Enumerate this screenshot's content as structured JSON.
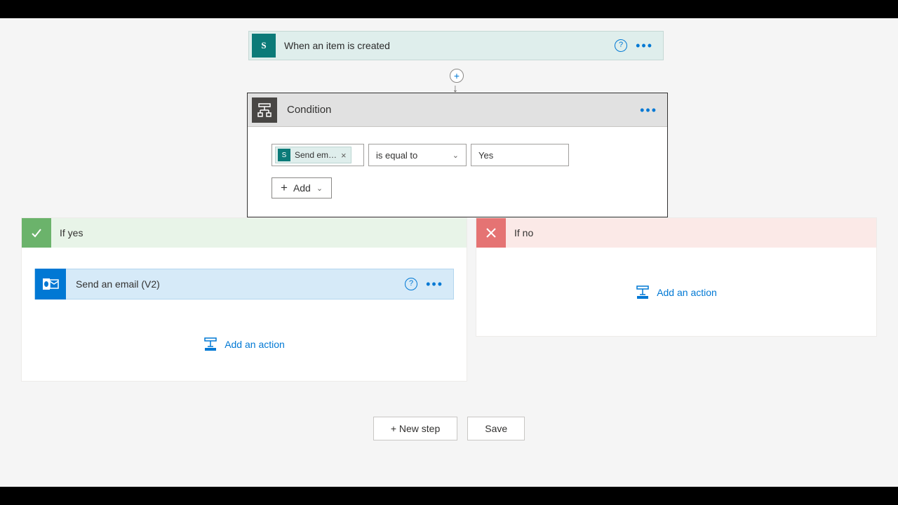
{
  "trigger": {
    "title": "When an item is created",
    "connector_short": "S",
    "help_tooltip": "?"
  },
  "condition": {
    "title": "Condition",
    "left_operand_label": "Send em…",
    "operator": "is equal to",
    "value": "Yes",
    "add_label": "Add"
  },
  "branches": {
    "yes": {
      "label": "If yes",
      "actions": [
        {
          "title": "Send an email (V2)"
        }
      ],
      "add_action_label": "Add an action"
    },
    "no": {
      "label": "If no",
      "add_action_label": "Add an action"
    }
  },
  "footer": {
    "new_step": "+ New step",
    "save": "Save"
  }
}
